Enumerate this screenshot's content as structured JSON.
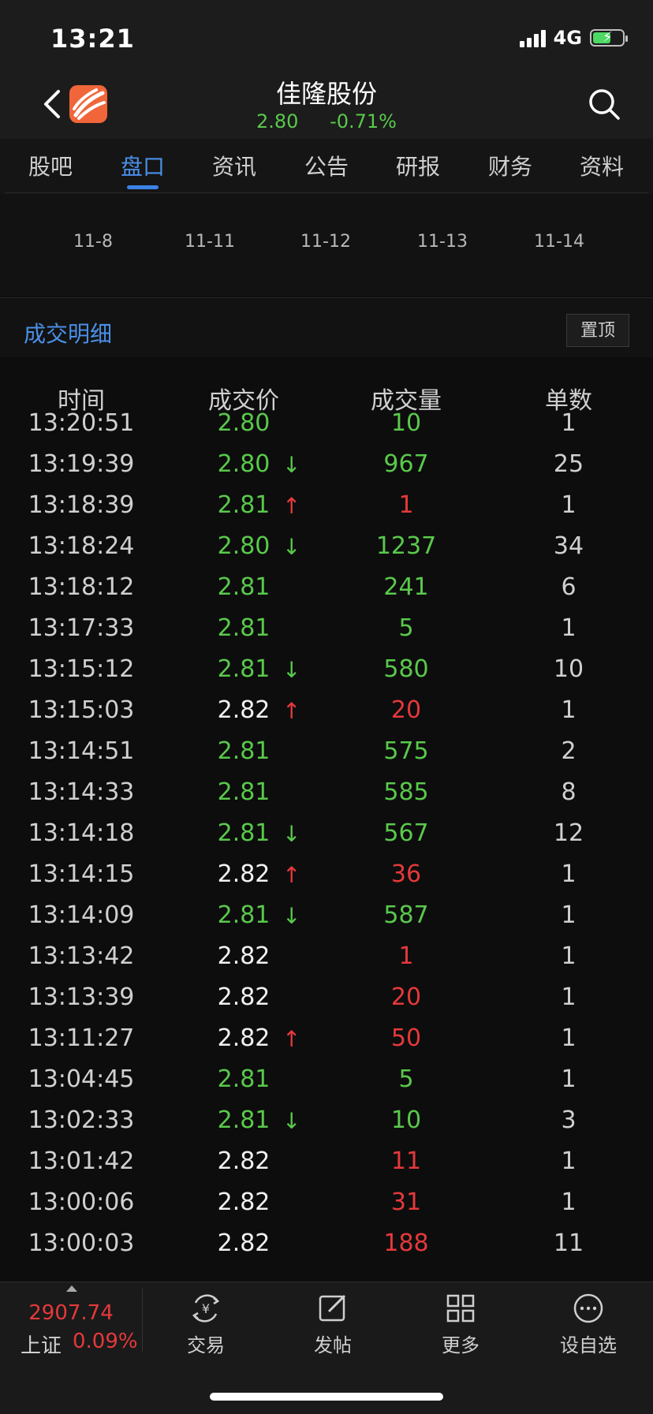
{
  "status_bar": {
    "time": "13:21",
    "network": "4G"
  },
  "header": {
    "stock_name": "佳隆股份",
    "price": "2.80",
    "change": "-0.71%"
  },
  "tabs": [
    {
      "label": "股吧",
      "active": false
    },
    {
      "label": "盘口",
      "active": true
    },
    {
      "label": "资讯",
      "active": false
    },
    {
      "label": "公告",
      "active": false
    },
    {
      "label": "研报",
      "active": false
    },
    {
      "label": "财务",
      "active": false
    },
    {
      "label": "资料",
      "active": false
    }
  ],
  "dates": [
    "11-8",
    "11-11",
    "11-12",
    "11-13",
    "11-14"
  ],
  "section": {
    "title": "成交明细",
    "pin_label": "置顶"
  },
  "table": {
    "columns": [
      "时间",
      "成交价",
      "成交量",
      "单数"
    ],
    "rows": [
      {
        "time": "13:20:51",
        "price": "2.80",
        "price_color": "green",
        "arrow": "",
        "volume": "10",
        "volume_color": "green",
        "count": "1"
      },
      {
        "time": "13:19:39",
        "price": "2.80",
        "price_color": "green",
        "arrow": "down",
        "volume": "967",
        "volume_color": "green",
        "count": "25"
      },
      {
        "time": "13:18:39",
        "price": "2.81",
        "price_color": "green",
        "arrow": "up",
        "volume": "1",
        "volume_color": "red",
        "count": "1"
      },
      {
        "time": "13:18:24",
        "price": "2.80",
        "price_color": "green",
        "arrow": "down",
        "volume": "1237",
        "volume_color": "green",
        "count": "34"
      },
      {
        "time": "13:18:12",
        "price": "2.81",
        "price_color": "green",
        "arrow": "",
        "volume": "241",
        "volume_color": "green",
        "count": "6"
      },
      {
        "time": "13:17:33",
        "price": "2.81",
        "price_color": "green",
        "arrow": "",
        "volume": "5",
        "volume_color": "green",
        "count": "1"
      },
      {
        "time": "13:15:12",
        "price": "2.81",
        "price_color": "green",
        "arrow": "down",
        "volume": "580",
        "volume_color": "green",
        "count": "10"
      },
      {
        "time": "13:15:03",
        "price": "2.82",
        "price_color": "white",
        "arrow": "up",
        "volume": "20",
        "volume_color": "red",
        "count": "1"
      },
      {
        "time": "13:14:51",
        "price": "2.81",
        "price_color": "green",
        "arrow": "",
        "volume": "575",
        "volume_color": "green",
        "count": "2"
      },
      {
        "time": "13:14:33",
        "price": "2.81",
        "price_color": "green",
        "arrow": "",
        "volume": "585",
        "volume_color": "green",
        "count": "8"
      },
      {
        "time": "13:14:18",
        "price": "2.81",
        "price_color": "green",
        "arrow": "down",
        "volume": "567",
        "volume_color": "green",
        "count": "12"
      },
      {
        "time": "13:14:15",
        "price": "2.82",
        "price_color": "white",
        "arrow": "up",
        "volume": "36",
        "volume_color": "red",
        "count": "1"
      },
      {
        "time": "13:14:09",
        "price": "2.81",
        "price_color": "green",
        "arrow": "down",
        "volume": "587",
        "volume_color": "green",
        "count": "1"
      },
      {
        "time": "13:13:42",
        "price": "2.82",
        "price_color": "white",
        "arrow": "",
        "volume": "1",
        "volume_color": "red",
        "count": "1"
      },
      {
        "time": "13:13:39",
        "price": "2.82",
        "price_color": "white",
        "arrow": "",
        "volume": "20",
        "volume_color": "red",
        "count": "1"
      },
      {
        "time": "13:11:27",
        "price": "2.82",
        "price_color": "white",
        "arrow": "up",
        "volume": "50",
        "volume_color": "red",
        "count": "1"
      },
      {
        "time": "13:04:45",
        "price": "2.81",
        "price_color": "green",
        "arrow": "",
        "volume": "5",
        "volume_color": "green",
        "count": "1"
      },
      {
        "time": "13:02:33",
        "price": "2.81",
        "price_color": "green",
        "arrow": "down",
        "volume": "10",
        "volume_color": "green",
        "count": "3"
      },
      {
        "time": "13:01:42",
        "price": "2.82",
        "price_color": "white",
        "arrow": "",
        "volume": "11",
        "volume_color": "red",
        "count": "1"
      },
      {
        "time": "13:00:06",
        "price": "2.82",
        "price_color": "white",
        "arrow": "",
        "volume": "31",
        "volume_color": "red",
        "count": "1"
      },
      {
        "time": "13:00:03",
        "price": "2.82",
        "price_color": "white",
        "arrow": "",
        "volume": "188",
        "volume_color": "red",
        "count": "11"
      }
    ]
  },
  "tabbar": {
    "index": {
      "value": "2907.74",
      "name": "上证",
      "change": "0.09%"
    },
    "items": [
      {
        "label": "交易",
        "icon": "trade-icon"
      },
      {
        "label": "发帖",
        "icon": "compose-icon"
      },
      {
        "label": "更多",
        "icon": "grid-icon"
      },
      {
        "label": "设自选",
        "icon": "more-dots-icon"
      }
    ]
  },
  "colors": {
    "up": "#e5393b",
    "down": "#59c94b",
    "accent": "#4a8fe7"
  }
}
